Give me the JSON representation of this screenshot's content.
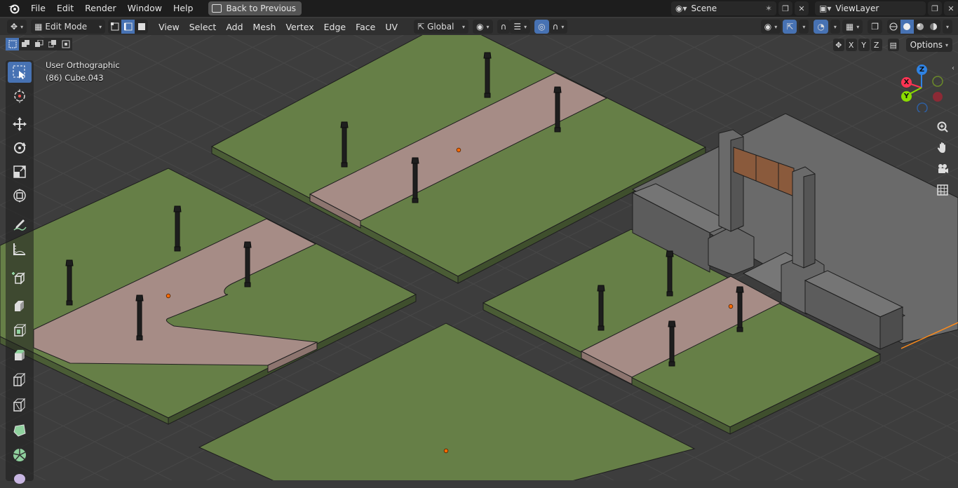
{
  "menubar": {
    "items": [
      "File",
      "Edit",
      "Render",
      "Window",
      "Help"
    ],
    "back_label": "Back to Previous"
  },
  "scene_selector": {
    "scene": "Scene",
    "view_layer": "ViewLayer"
  },
  "header": {
    "mode": "Edit Mode",
    "menus": [
      "View",
      "Select",
      "Add",
      "Mesh",
      "Vertex",
      "Edge",
      "Face",
      "UV"
    ],
    "orientation": "Global"
  },
  "viewport": {
    "view_name": "User Orthographic",
    "object_info": "(86) Cube.043",
    "options_label": "Options",
    "axes": [
      "X",
      "Y",
      "Z"
    ]
  },
  "gizmo": {
    "x": "X",
    "y": "Y",
    "z": "Z"
  },
  "colors": {
    "grass": "#667f47",
    "path": "#a68c86",
    "pillar": "#5a5a5a",
    "wall": "#656565",
    "accent": "#4772b3",
    "lamp": "#1e1e1e",
    "origin": "#ff6a00"
  },
  "tools": [
    "select-box",
    "cursor",
    "move",
    "rotate",
    "scale",
    "transform",
    "annotate",
    "measure",
    "add-cube",
    "extrude",
    "inset",
    "bevel",
    "loop-cut",
    "knife",
    "poly-build",
    "spin",
    "smooth"
  ]
}
